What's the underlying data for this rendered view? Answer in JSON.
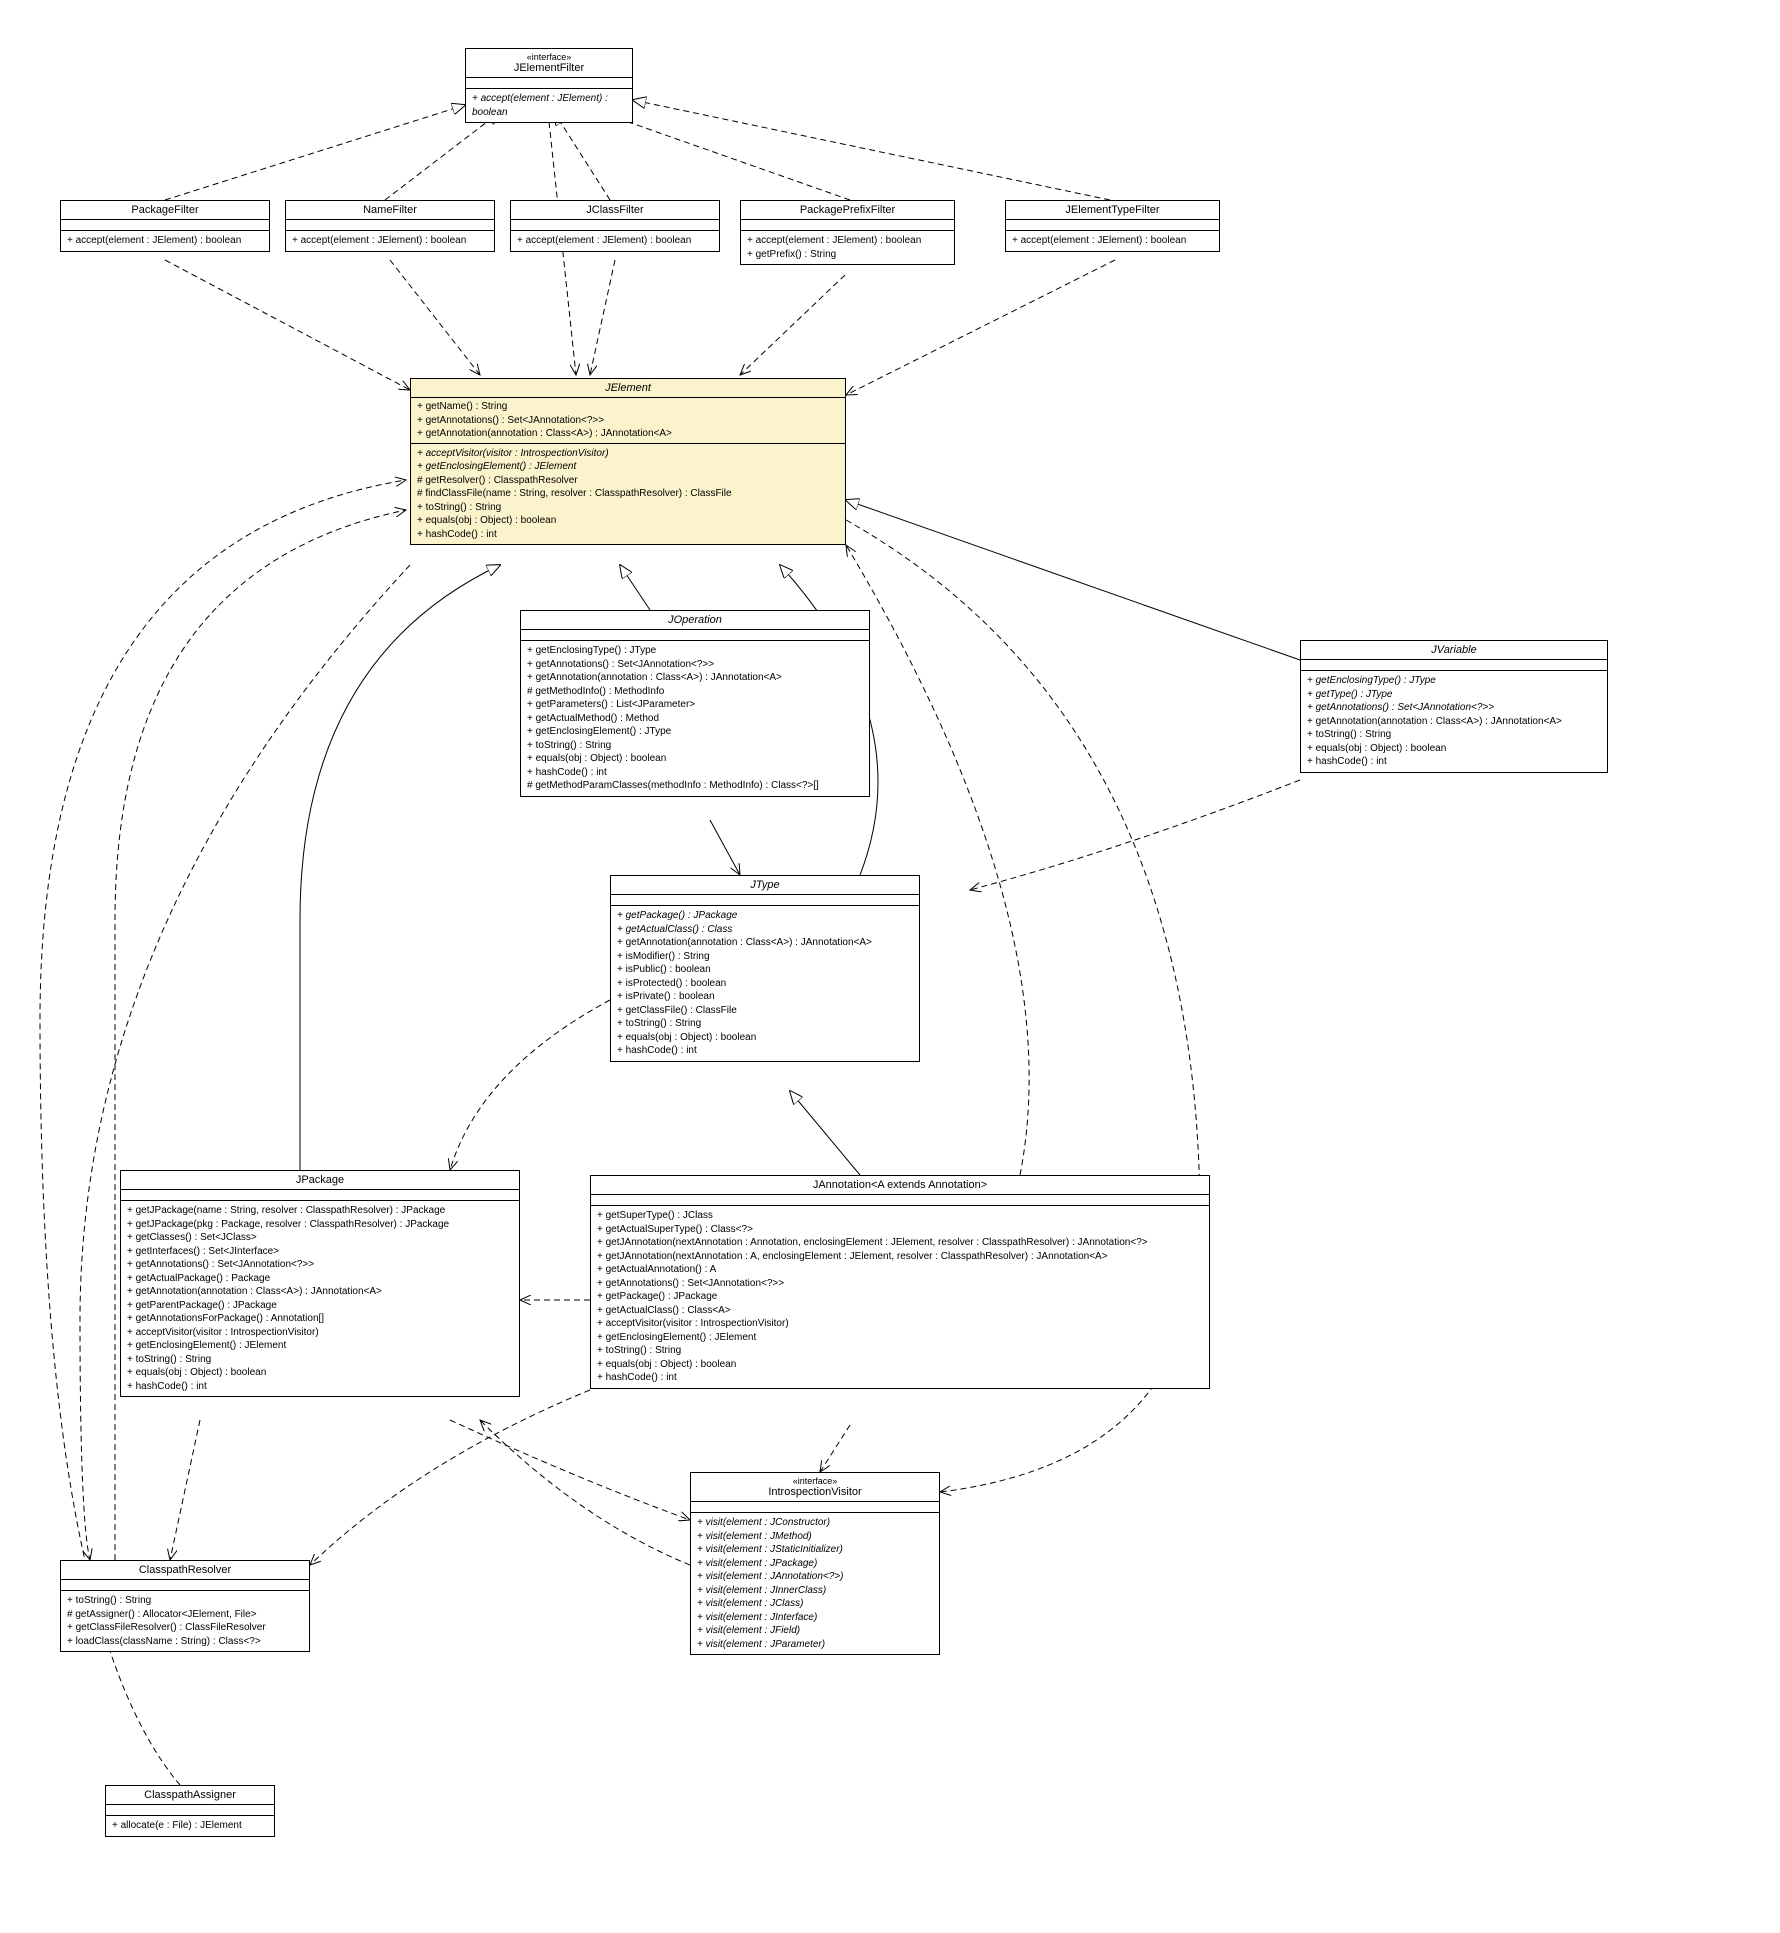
{
  "classes": {
    "JElementFilter": {
      "stereotype": "«interface»",
      "name": "JElementFilter",
      "ops": [
        {
          "text": "+ accept(element : JElement) : boolean",
          "italic": true
        }
      ]
    },
    "PackageFilter": {
      "name": "PackageFilter",
      "ops": [
        {
          "text": "+ accept(element : JElement) : boolean"
        }
      ]
    },
    "NameFilter": {
      "name": "NameFilter",
      "ops": [
        {
          "text": "+ accept(element : JElement) : boolean"
        }
      ]
    },
    "JClassFilter": {
      "name": "JClassFilter",
      "ops": [
        {
          "text": "+ accept(element : JElement) : boolean"
        }
      ]
    },
    "PackagePrefixFilter": {
      "name": "PackagePrefixFilter",
      "ops": [
        {
          "text": "+ accept(element : JElement) : boolean"
        },
        {
          "text": "+ getPrefix() : String"
        }
      ]
    },
    "JElementTypeFilter": {
      "name": "JElementTypeFilter",
      "ops": [
        {
          "text": "+ accept(element : JElement) : boolean"
        }
      ]
    },
    "JElement": {
      "name": "JElement",
      "italicTitle": true,
      "attrs": [
        "+ getName() : String",
        "+ getAnnotations() : Set<JAnnotation<?>>",
        "+ getAnnotation(annotation : Class<A>) : JAnnotation<A>"
      ],
      "ops": [
        {
          "text": "+ acceptVisitor(visitor : IntrospectionVisitor)",
          "italic": true
        },
        {
          "text": "+ getEnclosingElement() : JElement",
          "italic": true
        },
        {
          "text": "# getResolver() : ClasspathResolver"
        },
        {
          "text": "# findClassFile(name : String, resolver : ClasspathResolver) : ClassFile"
        },
        {
          "text": "+ toString() : String"
        },
        {
          "text": "+ equals(obj : Object) : boolean"
        },
        {
          "text": "+ hashCode() : int"
        }
      ]
    },
    "JOperation": {
      "name": "JOperation",
      "italicTitle": true,
      "ops": [
        {
          "text": "+ getEnclosingType() : JType"
        },
        {
          "text": "+ getAnnotations() : Set<JAnnotation<?>>"
        },
        {
          "text": "+ getAnnotation(annotation : Class<A>) : JAnnotation<A>"
        },
        {
          "text": "# getMethodInfo() : MethodInfo"
        },
        {
          "text": "+ getParameters() : List<JParameter>"
        },
        {
          "text": "+ getActualMethod() : Method"
        },
        {
          "text": "+ getEnclosingElement() : JType"
        },
        {
          "text": "+ toString() : String"
        },
        {
          "text": "+ equals(obj : Object) : boolean"
        },
        {
          "text": "+ hashCode() : int"
        },
        {
          "text": "# getMethodParamClasses(methodInfo : MethodInfo) : Class<?>[]"
        }
      ]
    },
    "JVariable": {
      "name": "JVariable",
      "italicTitle": true,
      "ops": [
        {
          "text": "+ getEnclosingType() : JType",
          "italic": true
        },
        {
          "text": "+ getType() : JType",
          "italic": true
        },
        {
          "text": "+ getAnnotations() : Set<JAnnotation<?>>",
          "italic": true
        },
        {
          "text": "+ getAnnotation(annotation : Class<A>) : JAnnotation<A>"
        },
        {
          "text": "+ toString() : String"
        },
        {
          "text": "+ equals(obj : Object) : boolean"
        },
        {
          "text": "+ hashCode() : int"
        }
      ]
    },
    "JType": {
      "name": "JType",
      "italicTitle": true,
      "ops": [
        {
          "text": "+ getPackage() : JPackage",
          "italic": true
        },
        {
          "text": "+ getActualClass() : Class",
          "italic": true
        },
        {
          "text": "+ getAnnotation(annotation : Class<A>) : JAnnotation<A>"
        },
        {
          "text": "+ isModifier() : String"
        },
        {
          "text": "+ isPublic() : boolean"
        },
        {
          "text": "+ isProtected() : boolean"
        },
        {
          "text": "+ isPrivate() : boolean"
        },
        {
          "text": "+ getClassFile() : ClassFile"
        },
        {
          "text": "+ toString() : String"
        },
        {
          "text": "+ equals(obj : Object) : boolean"
        },
        {
          "text": "+ hashCode() : int"
        }
      ]
    },
    "JPackage": {
      "name": "JPackage",
      "ops": [
        {
          "text": "+ getJPackage(name : String, resolver : ClasspathResolver) : JPackage"
        },
        {
          "text": "+ getJPackage(pkg : Package, resolver : ClasspathResolver) : JPackage"
        },
        {
          "text": "+ getClasses() : Set<JClass>"
        },
        {
          "text": "+ getInterfaces() : Set<JInterface>"
        },
        {
          "text": "+ getAnnotations() : Set<JAnnotation<?>>"
        },
        {
          "text": "+ getActualPackage() : Package"
        },
        {
          "text": "+ getAnnotation(annotation : Class<A>) : JAnnotation<A>"
        },
        {
          "text": "+ getParentPackage() : JPackage"
        },
        {
          "text": "+ getAnnotationsForPackage() : Annotation[]"
        },
        {
          "text": "+ acceptVisitor(visitor : IntrospectionVisitor)"
        },
        {
          "text": "+ getEnclosingElement() : JElement"
        },
        {
          "text": "+ toString() : String"
        },
        {
          "text": "+ equals(obj : Object) : boolean"
        },
        {
          "text": "+ hashCode() : int"
        }
      ]
    },
    "JAnnotation": {
      "name": "JAnnotation<A extends Annotation>",
      "ops": [
        {
          "text": "+ getSuperType() : JClass"
        },
        {
          "text": "+ getActualSuperType() : Class<?>"
        },
        {
          "text": "+ getJAnnotation(nextAnnotation : Annotation, enclosingElement : JElement, resolver : ClasspathResolver) : JAnnotation<?>"
        },
        {
          "text": "+ getJAnnotation(nextAnnotation : A, enclosingElement : JElement, resolver : ClasspathResolver) : JAnnotation<A>"
        },
        {
          "text": "+ getActualAnnotation() : A"
        },
        {
          "text": "+ getAnnotations() : Set<JAnnotation<?>>"
        },
        {
          "text": "+ getPackage() : JPackage"
        },
        {
          "text": "+ getActualClass() : Class<A>"
        },
        {
          "text": "+ acceptVisitor(visitor : IntrospectionVisitor)"
        },
        {
          "text": "+ getEnclosingElement() : JElement"
        },
        {
          "text": "+ toString() : String"
        },
        {
          "text": "+ equals(obj : Object) : boolean"
        },
        {
          "text": "+ hashCode() : int"
        }
      ]
    },
    "IntrospectionVisitor": {
      "stereotype": "«interface»",
      "name": "IntrospectionVisitor",
      "ops": [
        {
          "text": "+ visit(element : JConstructor)",
          "italic": true
        },
        {
          "text": "+ visit(element : JMethod)",
          "italic": true
        },
        {
          "text": "+ visit(element : JStaticInitializer)",
          "italic": true
        },
        {
          "text": "+ visit(element : JPackage)",
          "italic": true
        },
        {
          "text": "+ visit(element : JAnnotation<?>)",
          "italic": true
        },
        {
          "text": "+ visit(element : JInnerClass)",
          "italic": true
        },
        {
          "text": "+ visit(element : JClass)",
          "italic": true
        },
        {
          "text": "+ visit(element : JInterface)",
          "italic": true
        },
        {
          "text": "+ visit(element : JField)",
          "italic": true
        },
        {
          "text": "+ visit(element : JParameter)",
          "italic": true
        }
      ]
    },
    "ClasspathResolver": {
      "name": "ClasspathResolver",
      "ops": [
        {
          "text": "+ toString() : String"
        },
        {
          "text": "# getAssigner() : Allocator<JElement, File>"
        },
        {
          "text": "+ getClassFileResolver() : ClassFileResolver"
        },
        {
          "text": "+ loadClass(className : String) : Class<?>"
        }
      ]
    },
    "ClasspathAssigner": {
      "name": "ClasspathAssigner",
      "ops": [
        {
          "text": "+ allocate(e : File) : JElement"
        }
      ]
    }
  },
  "relationships": [
    {
      "from": "PackageFilter",
      "to": "JElementFilter",
      "type": "realization"
    },
    {
      "from": "NameFilter",
      "to": "JElementFilter",
      "type": "realization"
    },
    {
      "from": "JClassFilter",
      "to": "JElementFilter",
      "type": "realization"
    },
    {
      "from": "PackagePrefixFilter",
      "to": "JElementFilter",
      "type": "realization"
    },
    {
      "from": "JElementTypeFilter",
      "to": "JElementFilter",
      "type": "realization"
    },
    {
      "from": "PackageFilter",
      "to": "JElement",
      "type": "dependency"
    },
    {
      "from": "NameFilter",
      "to": "JElement",
      "type": "dependency"
    },
    {
      "from": "JClassFilter",
      "to": "JElement",
      "type": "dependency"
    },
    {
      "from": "PackagePrefixFilter",
      "to": "JElement",
      "type": "dependency"
    },
    {
      "from": "JElementTypeFilter",
      "to": "JElement",
      "type": "dependency"
    },
    {
      "from": "JElementFilter",
      "to": "JElement",
      "type": "dependency"
    },
    {
      "from": "JOperation",
      "to": "JElement",
      "type": "generalization"
    },
    {
      "from": "JVariable",
      "to": "JElement",
      "type": "generalization"
    },
    {
      "from": "JPackage",
      "to": "JElement",
      "type": "generalization"
    },
    {
      "from": "JType",
      "to": "JElement",
      "type": "generalization"
    },
    {
      "from": "JAnnotation",
      "to": "JType",
      "type": "generalization"
    },
    {
      "from": "JOperation",
      "to": "JType",
      "type": "association"
    },
    {
      "from": "JType",
      "to": "JPackage",
      "type": "dependency"
    },
    {
      "from": "JVariable",
      "to": "JType",
      "type": "dependency"
    },
    {
      "from": "JElement",
      "to": "IntrospectionVisitor",
      "type": "dependency"
    },
    {
      "from": "JElement",
      "to": "ClasspathResolver",
      "type": "dependency"
    },
    {
      "from": "JPackage",
      "to": "ClasspathResolver",
      "type": "dependency"
    },
    {
      "from": "JPackage",
      "to": "IntrospectionVisitor",
      "type": "dependency"
    },
    {
      "from": "JAnnotation",
      "to": "ClasspathResolver",
      "type": "dependency"
    },
    {
      "from": "JAnnotation",
      "to": "IntrospectionVisitor",
      "type": "dependency"
    },
    {
      "from": "JAnnotation",
      "to": "JElement",
      "type": "dependency"
    },
    {
      "from": "JAnnotation",
      "to": "JPackage",
      "type": "dependency"
    },
    {
      "from": "IntrospectionVisitor",
      "to": "JPackage",
      "type": "dependency"
    },
    {
      "from": "ClasspathResolver",
      "to": "JElement",
      "type": "dependency"
    },
    {
      "from": "ClasspathAssigner",
      "to": "JElement",
      "type": "dependency"
    }
  ]
}
